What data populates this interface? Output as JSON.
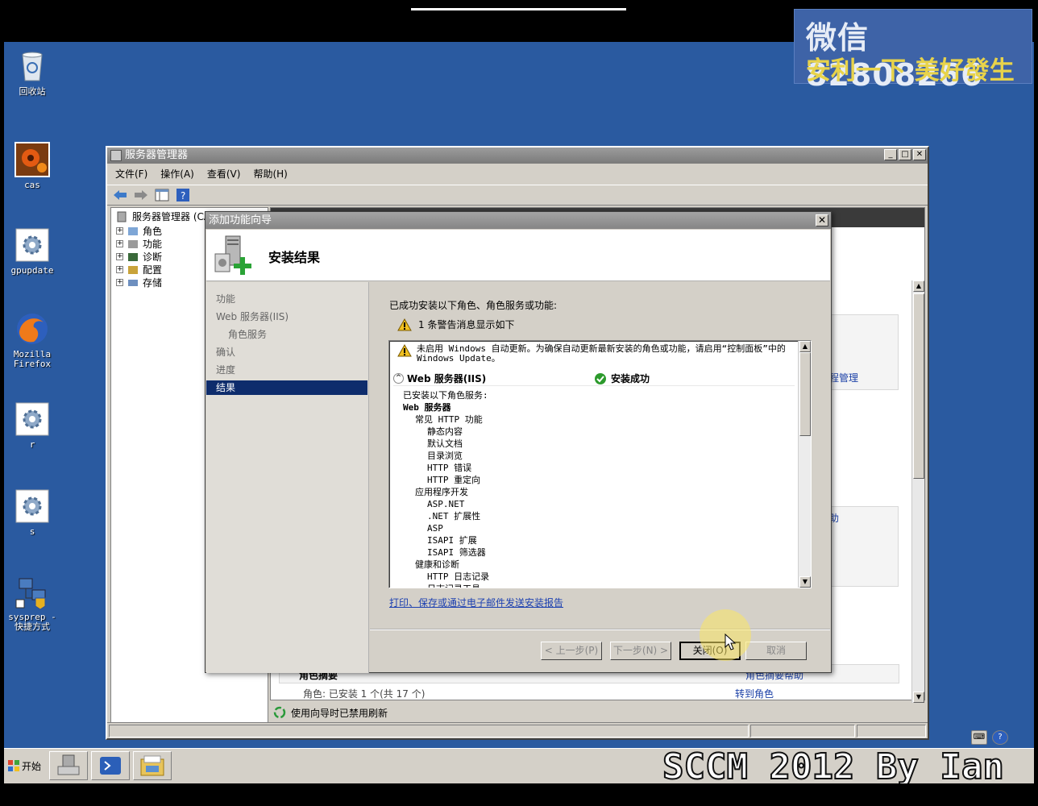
{
  "watermark": {
    "line1": "微信 82808266",
    "line2": "安利一下 美好發生"
  },
  "desktop_icons": [
    {
      "label": "回收站"
    },
    {
      "label": "cas"
    },
    {
      "label": "gpupdate"
    },
    {
      "label": "Mozilla Firefox"
    },
    {
      "label": "r"
    },
    {
      "label": "s"
    },
    {
      "label": "sysprep - 快捷方式"
    }
  ],
  "server_manager": {
    "title": "服务器管理器",
    "menus": [
      "文件(F)",
      "操作(A)",
      "查看(V)",
      "帮助(H)"
    ],
    "tree_root": "服务器管理器 (CA)",
    "tree_items": [
      "角色",
      "功能",
      "诊断",
      "配置",
      "存储"
    ],
    "right_partial_texts": [
      "程管理",
      "助",
      "角色摘要",
      "角色摘要帮助",
      "角色: 已安装 1 个(共 17 个)",
      "转到角色"
    ],
    "refresh_status": "使用向导时已禁用刷新"
  },
  "wizard": {
    "title": "添加功能向导",
    "header": "安装结果",
    "nav": [
      {
        "label": "功能",
        "sub": false,
        "selected": false
      },
      {
        "label": "Web 服务器(IIS)",
        "sub": false,
        "selected": false
      },
      {
        "label": "角色服务",
        "sub": true,
        "selected": false
      },
      {
        "label": "确认",
        "sub": false,
        "selected": false
      },
      {
        "label": "进度",
        "sub": false,
        "selected": false
      },
      {
        "label": "结果",
        "sub": false,
        "selected": true
      }
    ],
    "intro": "已成功安装以下角色、角色服务或功能:",
    "warning_summary": "1 条警告消息显示如下",
    "result_warning": "未启用 Windows 自动更新。为确保自动更新最新安装的角色或功能，请启用“控制面板”中的 Windows Update。",
    "role_name": "Web 服务器(IIS)",
    "role_status": "安装成功",
    "installed_lines": [
      {
        "text": "已安装以下角色服务:",
        "indent": 0,
        "bold": false
      },
      {
        "text": "Web 服务器",
        "indent": 0,
        "bold": true
      },
      {
        "text": "常见 HTTP 功能",
        "indent": 1,
        "bold": false
      },
      {
        "text": "静态内容",
        "indent": 2,
        "bold": false
      },
      {
        "text": "默认文档",
        "indent": 2,
        "bold": false
      },
      {
        "text": "目录浏览",
        "indent": 2,
        "bold": false
      },
      {
        "text": "HTTP 错误",
        "indent": 2,
        "bold": false
      },
      {
        "text": "HTTP 重定向",
        "indent": 2,
        "bold": false
      },
      {
        "text": "应用程序开发",
        "indent": 1,
        "bold": false
      },
      {
        "text": "ASP.NET",
        "indent": 2,
        "bold": false
      },
      {
        "text": ".NET 扩展性",
        "indent": 2,
        "bold": false
      },
      {
        "text": "ASP",
        "indent": 2,
        "bold": false
      },
      {
        "text": "ISAPI 扩展",
        "indent": 2,
        "bold": false
      },
      {
        "text": "ISAPI 筛选器",
        "indent": 2,
        "bold": false
      },
      {
        "text": "健康和诊断",
        "indent": 1,
        "bold": false
      },
      {
        "text": "HTTP 日志记录",
        "indent": 2,
        "bold": false
      },
      {
        "text": "日志记录工具",
        "indent": 2,
        "bold": false
      }
    ],
    "report_link": "打印、保存或通过电子邮件发送安装报告",
    "buttons": {
      "prev": "< 上一步(P)",
      "next": "下一步(N) >",
      "close": "关闭(O)",
      "cancel": "取消"
    }
  },
  "taskbar": {
    "start": "开始"
  },
  "overlay_caption": "SCCM 2012 By Ian",
  "colors": {
    "desktop": "#2a5aa0",
    "nav_selected": "#0e2c6c",
    "link": "#1b3fb0",
    "watermark_yellow": "#e8d34a"
  }
}
